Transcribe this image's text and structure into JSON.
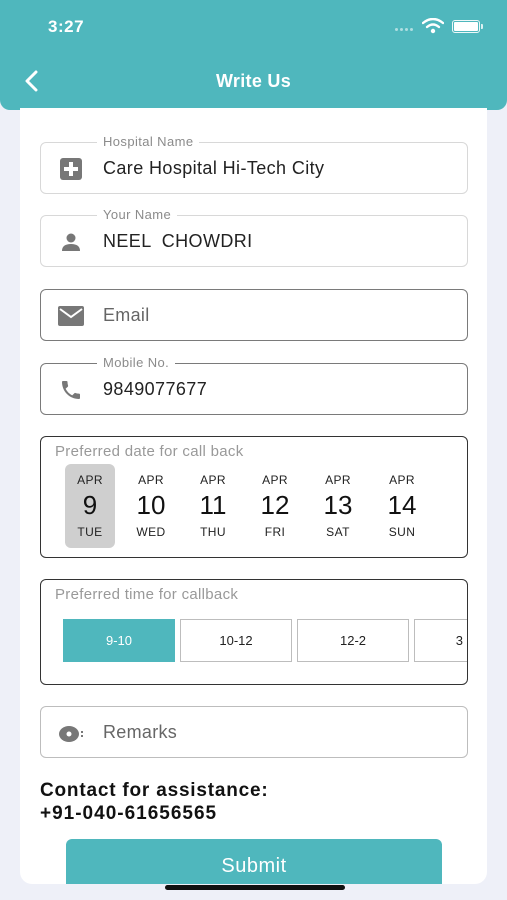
{
  "status_bar": {
    "time": "3:27"
  },
  "header": {
    "title": "Write Us"
  },
  "form": {
    "hospital": {
      "label": "Hospital Name",
      "value": "Care Hospital Hi-Tech City"
    },
    "name": {
      "label": "Your Name",
      "value": "NEEL  CHOWDRI"
    },
    "email": {
      "placeholder": "Email"
    },
    "mobile": {
      "label": "Mobile No.",
      "value": "9849077677"
    },
    "date_picker": {
      "label": "Preferred date for call back",
      "days": [
        {
          "month": "APR",
          "day": "9",
          "weekday": "TUE",
          "selected": true
        },
        {
          "month": "APR",
          "day": "10",
          "weekday": "WED"
        },
        {
          "month": "APR",
          "day": "11",
          "weekday": "THU"
        },
        {
          "month": "APR",
          "day": "12",
          "weekday": "FRI"
        },
        {
          "month": "APR",
          "day": "13",
          "weekday": "SAT"
        },
        {
          "month": "APR",
          "day": "14",
          "weekday": "SUN"
        }
      ]
    },
    "time_picker": {
      "label": "Preferred time for callback",
      "slots": [
        {
          "label": "9-10",
          "selected": true
        },
        {
          "label": "10-12"
        },
        {
          "label": "12-2"
        },
        {
          "label": "3"
        }
      ]
    },
    "remarks": {
      "placeholder": "Remarks"
    }
  },
  "contact": {
    "title": "Contact for assistance:",
    "phone": "+91-040-61656565"
  },
  "submit_label": "Submit",
  "colors": {
    "accent": "#4fb7bd",
    "selected_day": "#cfcfcf"
  }
}
